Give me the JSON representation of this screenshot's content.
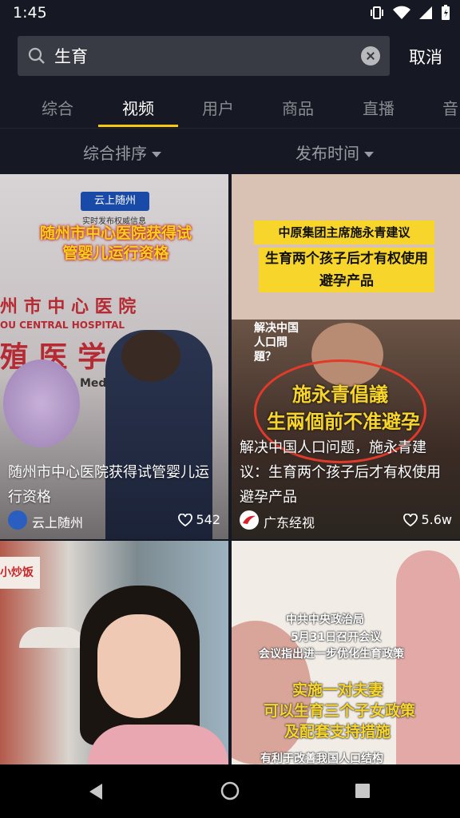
{
  "status_bar": {
    "time": "1:45"
  },
  "search": {
    "query": "生育",
    "cancel_label": "取消"
  },
  "tabs": [
    {
      "label": "综合"
    },
    {
      "label": "视频"
    },
    {
      "label": "用户"
    },
    {
      "label": "商品"
    },
    {
      "label": "直播"
    },
    {
      "label": "音"
    }
  ],
  "active_tab": "视频",
  "filters": {
    "sort_label": "综合排序",
    "time_label": "发布时间"
  },
  "videos": [
    {
      "title": "随州市中心医院获得试管婴儿运行资格",
      "author": "云上随州",
      "likes": "542",
      "thumb": {
        "badge": "云上随州",
        "badge_sub": "实时发布权威信息",
        "headline": "随州市中心医院获得试管婴儿运行资格",
        "sign_zh": "州 市 中 心 医 院",
        "sign_en": "OU CENTRAL HOSPITAL",
        "sign_big": "殖 医 学 中 心",
        "sign_center": "Med Center"
      }
    },
    {
      "title": "解决中国人口问题，施永青建议：生育两个孩子后才有权使用避孕产品",
      "author": "广东经视",
      "likes": "5.6w",
      "thumb": {
        "top_banner": "中原集团主席施永青建议",
        "main_banner": "生育两个孩子后才有权使用避孕产品",
        "question": "解决中国人口問題？",
        "trad_1": "施永青倡議",
        "trad_2": "生兩個前不准避孕"
      }
    },
    {
      "title": "",
      "thumb": {
        "sign": "小炒饭"
      }
    },
    {
      "title": "",
      "thumb": {
        "line1": "中共中央政治局",
        "line2": "5月31日召开会议",
        "line3": "会议指出进一步优化生育政策",
        "line4": "实施一对夫妻",
        "line5": "可以生育三个子女政策",
        "line6": "及配套支持措施",
        "line7": "有利于改善我国人口结构"
      }
    }
  ],
  "colors": {
    "background": "#161823",
    "accent": "#f6c90e",
    "search_bg": "#393b44"
  }
}
